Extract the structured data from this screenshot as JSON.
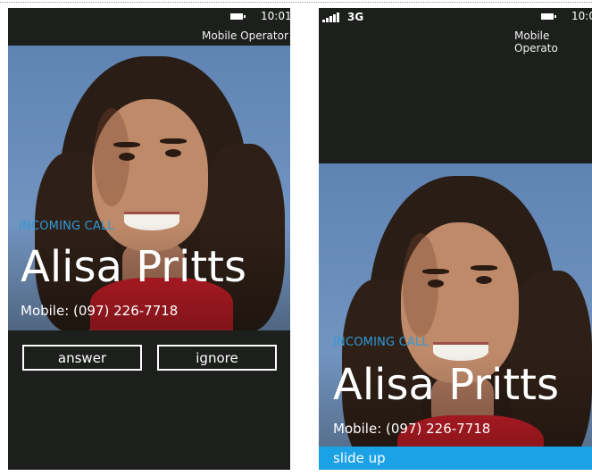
{
  "left_screen": {
    "status": {
      "time": "10:01",
      "operator": "Mobile Operator"
    },
    "call": {
      "label": "INCOMING CALL",
      "name": "Alisa Pritts",
      "number": "Mobile: (097) 226-7718"
    },
    "buttons": {
      "answer": "answer",
      "ignore": "ignore"
    }
  },
  "right_screen": {
    "status": {
      "network": "3G",
      "time": "10:0",
      "operator": "Mobile Operato"
    },
    "call": {
      "label": "INCOMING CALL",
      "name": "Alisa Pritts",
      "number": "Mobile: (097) 226-7718"
    },
    "slide": {
      "label": "slide up"
    }
  },
  "icons": [
    "signal-strength-icon",
    "battery-icon"
  ],
  "colors": {
    "accent": "#1aa1e6",
    "label_blue": "#2e9ad8",
    "screen_bg": "#1c1f1c",
    "scarf": "#c61e28"
  }
}
